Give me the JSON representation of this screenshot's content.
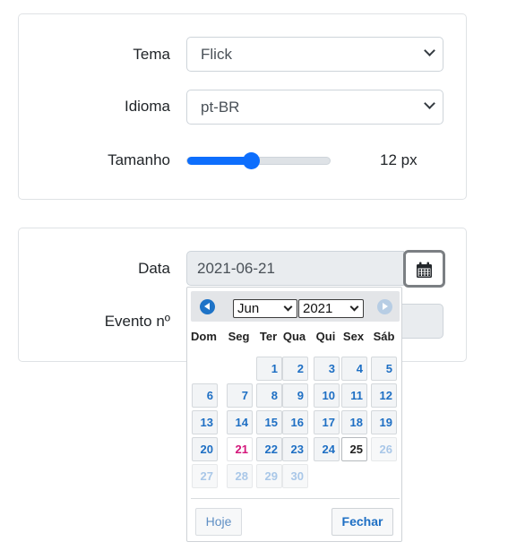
{
  "settings": {
    "theme_label": "Tema",
    "theme_value": "Flick",
    "language_label": "Idioma",
    "language_value": "pt-BR",
    "size_label": "Tamanho",
    "size_value": "12 px",
    "size_fraction": 0.44
  },
  "event": {
    "date_label": "Data",
    "date_value": "2021-06-21",
    "number_label": "Evento nº",
    "number_value": ""
  },
  "datepicker": {
    "month": "Jun",
    "year": "2021",
    "weekdays": [
      "Dom",
      "Seg",
      "Ter",
      "Qua",
      "Qui",
      "Sex",
      "Sáb"
    ],
    "weeks": [
      [
        null,
        null,
        "1",
        "2",
        "3",
        "4",
        "5"
      ],
      [
        "6",
        "7",
        "8",
        "9",
        "10",
        "11",
        "12"
      ],
      [
        "13",
        "14",
        "15",
        "16",
        "17",
        "18",
        "19"
      ],
      [
        "20",
        "21",
        "22",
        "23",
        "24",
        "25",
        "26"
      ],
      [
        "27",
        "28",
        "29",
        "30",
        null,
        null,
        null
      ]
    ],
    "selected_day": "21",
    "today_day": "25",
    "today_button": "Hoje",
    "close_button": "Fechar",
    "accent_color": "#1e6fc4",
    "selected_color": "#d4157a"
  }
}
